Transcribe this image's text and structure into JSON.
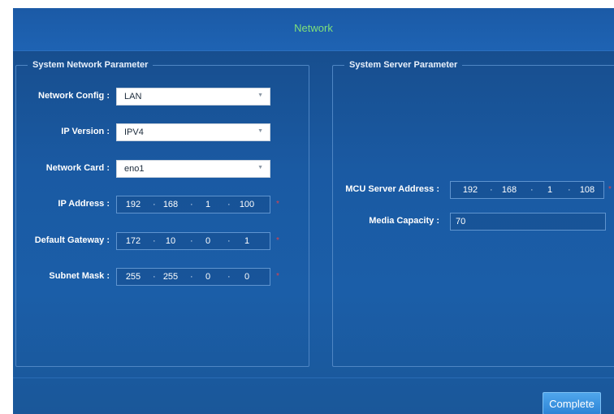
{
  "window": {
    "title": "Network"
  },
  "network_group": {
    "legend": "System Network Parameter",
    "network_config": {
      "label": "Network Config :",
      "value": "LAN"
    },
    "ip_version": {
      "label": "IP Version :",
      "value": "IPV4"
    },
    "network_card": {
      "label": "Network Card :",
      "value": "eno1"
    },
    "ip_address": {
      "label": "IP Address :",
      "octets": [
        "192",
        "168",
        "1",
        "100"
      ],
      "required": "*"
    },
    "default_gateway": {
      "label": "Default Gateway :",
      "octets": [
        "172",
        "10",
        "0",
        "1"
      ],
      "required": "*"
    },
    "subnet_mask": {
      "label": "Subnet Mask :",
      "octets": [
        "255",
        "255",
        "0",
        "0"
      ],
      "required": "*"
    }
  },
  "server_group": {
    "legend": "System Server Parameter",
    "mcu_server_address": {
      "label": "MCU Server Address :",
      "octets": [
        "192",
        "168",
        "1",
        "108"
      ],
      "required": "*"
    },
    "media_capacity": {
      "label": "Media Capacity :",
      "value": "70"
    }
  },
  "footer": {
    "complete_label": "Complete"
  },
  "icons": {
    "dropdown": "chevron-down-icon",
    "separator": "dot-separator"
  },
  "colors": {
    "title": "#7fe07a",
    "background": "#1b5ea8",
    "accent_button": "#3a92e0",
    "required": "#e0404a"
  }
}
